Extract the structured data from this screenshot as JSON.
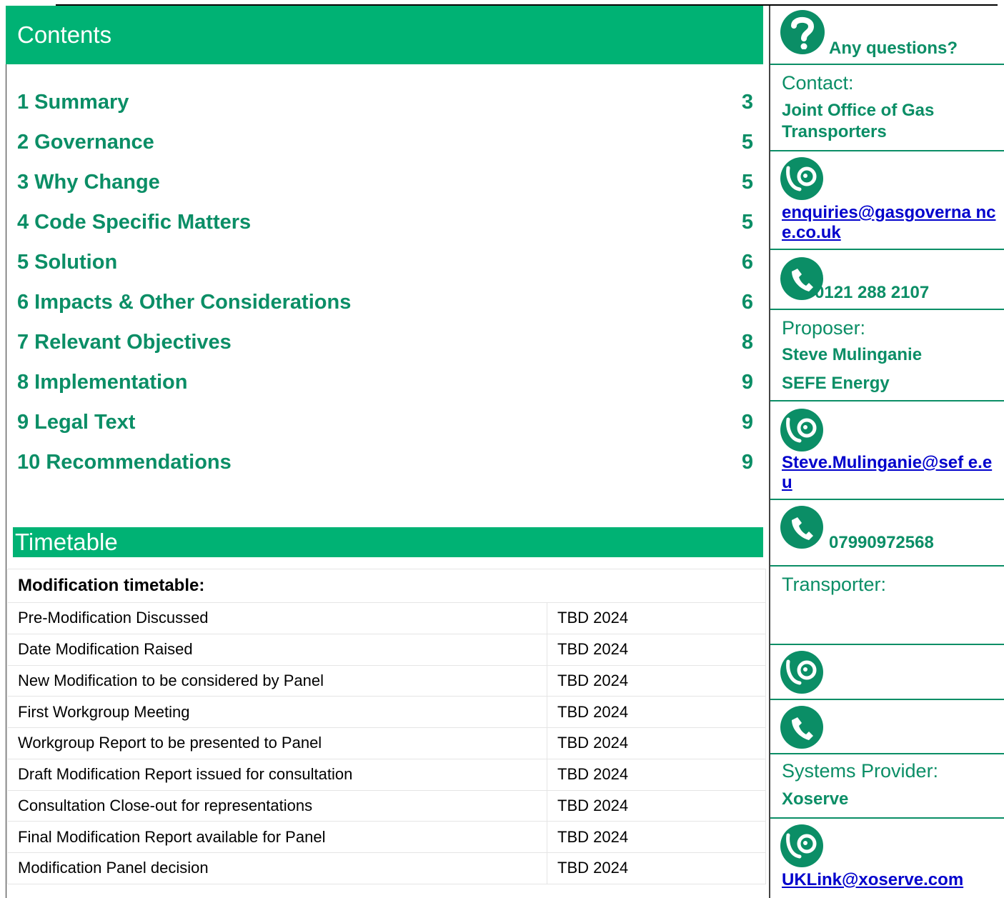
{
  "contents": {
    "title": "Contents",
    "items": [
      {
        "label": "1 Summary",
        "page": "3"
      },
      {
        "label": "2 Governance",
        "page": "5"
      },
      {
        "label": "3 Why Change",
        "page": "5"
      },
      {
        "label": "4 Code Specific Matters",
        "page": "5"
      },
      {
        "label": "5 Solution",
        "page": "6"
      },
      {
        "label": "6 Impacts & Other Considerations",
        "page": "6"
      },
      {
        "label": "7 Relevant Objectives",
        "page": "8"
      },
      {
        "label": "8 Implementation",
        "page": "9"
      },
      {
        "label": "9 Legal Text",
        "page": "9"
      },
      {
        "label": "10 Recommendations",
        "page": "9"
      }
    ]
  },
  "timetable": {
    "title": "Timetable",
    "table_heading": "Modification timetable:",
    "rows": [
      {
        "event": "Pre-Modification Discussed",
        "date": "TBD 2024"
      },
      {
        "event": "Date Modification Raised",
        "date": "TBD 2024"
      },
      {
        "event": "New Modification to be considered by Panel",
        "date": "TBD 2024"
      },
      {
        "event": "First Workgroup Meeting",
        "date": "TBD 2024"
      },
      {
        "event": "Workgroup Report to be presented to Panel",
        "date": "TBD 2024"
      },
      {
        "event": "Draft Modification Report issued for consultation",
        "date": "TBD 2024"
      },
      {
        "event": "Consultation Close-out for representations",
        "date": "TBD 2024"
      },
      {
        "event": "Final Modification Report available for Panel",
        "date": "TBD 2024"
      },
      {
        "event": "Modification Panel decision",
        "date": "TBD 2024"
      }
    ]
  },
  "sidebar": {
    "questions": "Any questions?",
    "contact_label": "Contact:",
    "contact_name": "Joint Office of Gas Transporters",
    "contact_email": "enquiries@gasgoverna nce.co.uk",
    "contact_phone": "0121 288 2107",
    "proposer_label": "Proposer:",
    "proposer_name": "Steve Mulinganie",
    "proposer_org": "SEFE Energy",
    "proposer_email": "Steve.Mulinganie@sef e.eu",
    "proposer_phone": "07990972568",
    "transporter_label": "Transporter:",
    "systems_label": "Systems Provider:",
    "systems_name": "Xoserve",
    "systems_email": "UKLink@xoserve.com"
  },
  "colors": {
    "accent": "#00b274",
    "text_green": "#0b8e66",
    "link": "#0000cc"
  },
  "icons": [
    "question-mark-icon",
    "email-icon",
    "phone-icon"
  ]
}
